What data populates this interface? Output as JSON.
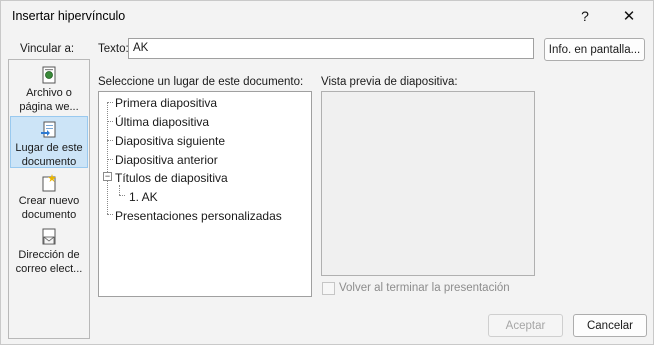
{
  "window": {
    "title": "Insertar hipervínculo",
    "help_glyph": "?",
    "close_glyph": "✕"
  },
  "link_to": {
    "label": "Vincular a:",
    "items": [
      {
        "line1": "Archivo o",
        "line2": "página we...",
        "icon": "web-page-icon"
      },
      {
        "line1": "Lugar de este",
        "line2": "documento",
        "icon": "place-in-document-icon",
        "selected": true
      },
      {
        "line1": "Crear nuevo",
        "line2": "documento",
        "icon": "new-document-icon"
      },
      {
        "line1": "Dirección de",
        "line2": "correo elect...",
        "icon": "email-address-icon"
      }
    ]
  },
  "text_field": {
    "label": "Texto:",
    "value": "AK"
  },
  "screentip_button": "Info. en pantalla...",
  "select_place": {
    "label": "Seleccione un lugar de este documento:",
    "tree": [
      {
        "text": "Primera diapositiva"
      },
      {
        "text": "Última diapositiva"
      },
      {
        "text": "Diapositiva siguiente"
      },
      {
        "text": "Diapositiva anterior"
      },
      {
        "text": "Títulos de diapositiva",
        "expander": "−"
      },
      {
        "text": "1. AK"
      },
      {
        "text": "Presentaciones personalizadas"
      }
    ]
  },
  "preview": {
    "label": "Vista previa de diapositiva:"
  },
  "return_checkbox": {
    "label": "Volver al terminar la presentación",
    "checked": false
  },
  "buttons": {
    "accept": "Aceptar",
    "cancel": "Cancelar"
  }
}
